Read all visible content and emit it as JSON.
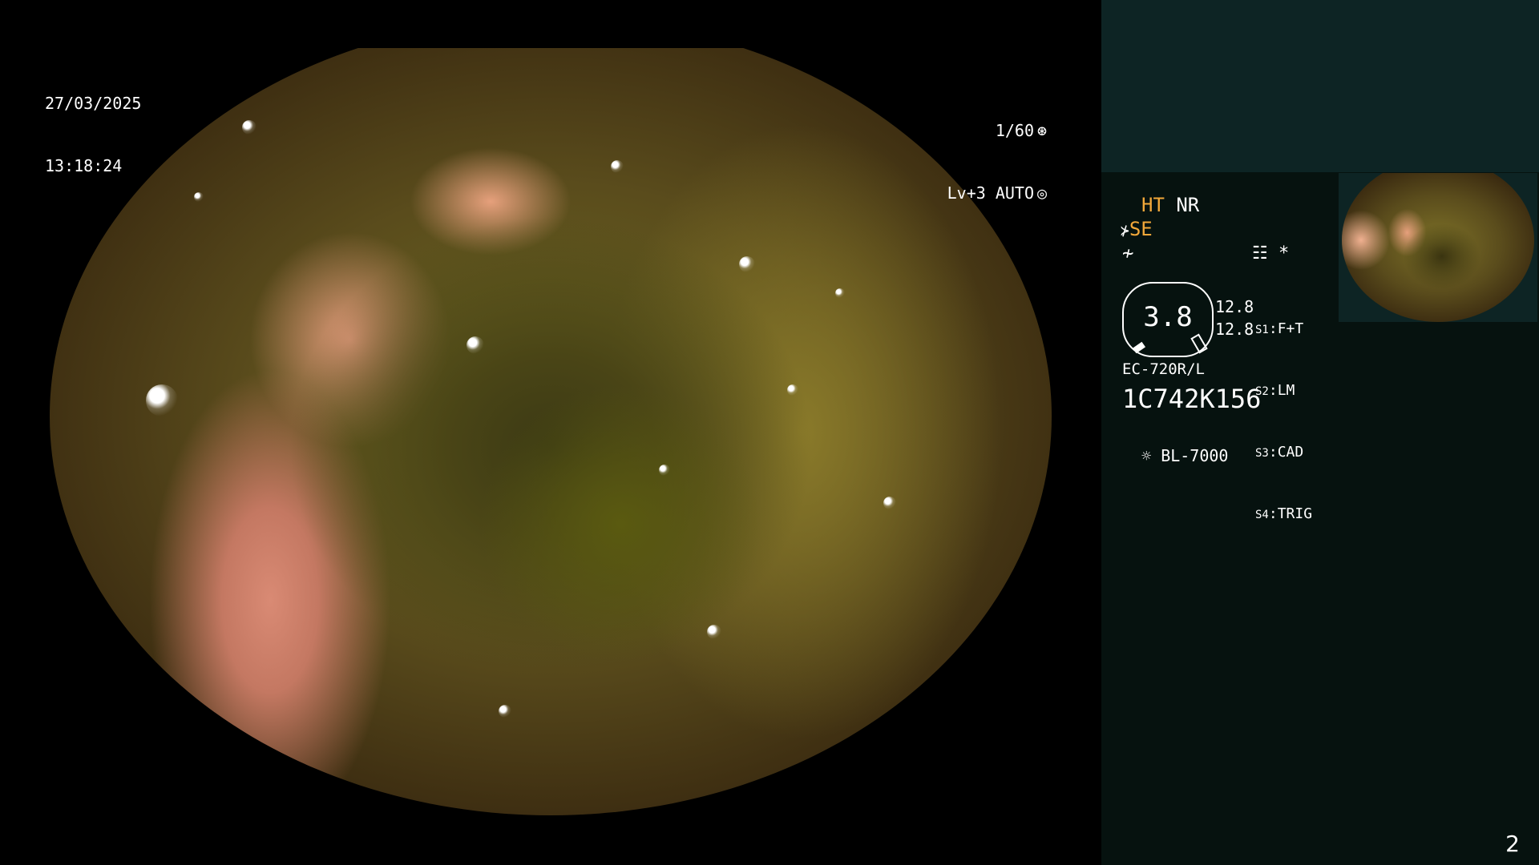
{
  "overlay": {
    "date": "27/03/2025",
    "time": "13:18:24",
    "shutter": "1/60",
    "shutter_icon": "aperture-icon",
    "level": "Lv+3 AUTO",
    "level_icon": "iris-icon"
  },
  "sidebar": {
    "modes": {
      "ht": "HT",
      "nr": "NR",
      "se": "SE",
      "se_icon": "enhance-icon",
      "f_icon": "filter-icon",
      "memo_icon": "memo-icon",
      "asterisk": "*"
    },
    "zoom": {
      "value": "3.8",
      "upper_value": "12.8",
      "lower_value": "12.8"
    },
    "switches": [
      {
        "key": "S1",
        "value": "F+T"
      },
      {
        "key": "S2",
        "value": "LM"
      },
      {
        "key": "S3",
        "value": "CAD"
      },
      {
        "key": "S4",
        "value": "TRIG"
      }
    ],
    "scope_model": "EC-720R/L",
    "serial": "1C742K156",
    "light_source_icon": "light-source-icon",
    "light_source": "BL-7000"
  },
  "page_number": "2",
  "colors": {
    "sidebar_bg": "#06120f",
    "sidebar_top_bg": "#0d2424",
    "accent_orange": "#f2a83a"
  }
}
